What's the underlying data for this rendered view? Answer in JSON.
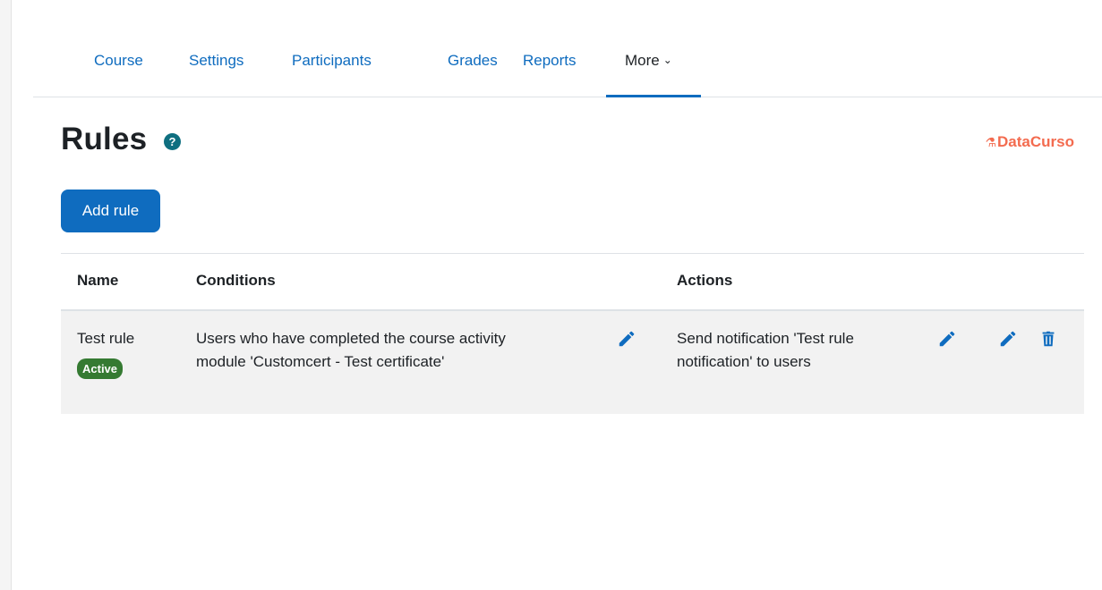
{
  "nav": {
    "tabs": [
      {
        "label": "Course"
      },
      {
        "label": "Settings"
      },
      {
        "label": "Participants"
      },
      {
        "label": "Grades"
      },
      {
        "label": "Reports"
      },
      {
        "label": "More"
      }
    ],
    "active_tab": "More"
  },
  "page": {
    "title": "Rules",
    "help_icon_glyph": "?",
    "brand": "DataCurso",
    "add_button": "Add rule"
  },
  "table": {
    "headers": [
      "Name",
      "Conditions",
      "Actions"
    ],
    "rows": [
      {
        "name": "Test rule",
        "status": "Active",
        "conditions": [
          "Users who have completed the course activity",
          "module 'Customcert - Test certificate'"
        ],
        "actions": [
          "Send notification 'Test rule",
          "notification' to users"
        ]
      }
    ]
  },
  "colors": {
    "link": "#0f6cbf",
    "badge_active": "#357a32",
    "brand": "#f36b4f",
    "help": "#0f6f80"
  },
  "icons": [
    "help-icon",
    "pencil-icon",
    "trash-icon",
    "chevron-down-icon",
    "brand-logo-icon"
  ]
}
